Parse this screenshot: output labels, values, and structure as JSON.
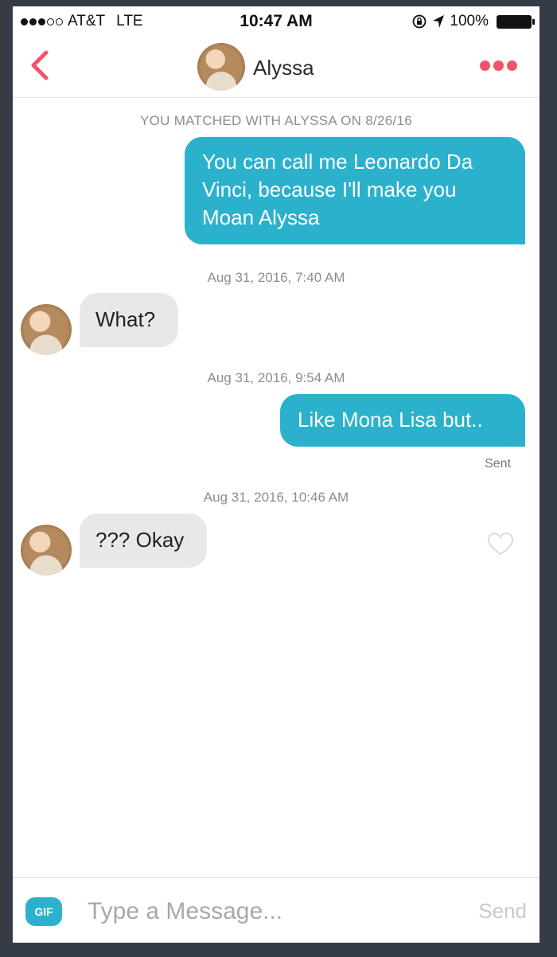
{
  "status_bar": {
    "carrier": "AT&T",
    "network": "LTE",
    "time": "10:47 AM",
    "battery": "100%"
  },
  "header": {
    "name": "Alyssa",
    "accent_color": "#f1536a"
  },
  "conversation": {
    "match_notice": "YOU MATCHED WITH ALYSSA ON 8/26/16",
    "messages": [
      {
        "from": "me",
        "text": "You can call me Leonardo Da Vinci, because I'll make you Moan Alyssa"
      },
      {
        "timestamp": "Aug 31, 2016, 7:40 AM"
      },
      {
        "from": "Alyssa",
        "text": "What?"
      },
      {
        "timestamp": "Aug 31, 2016, 9:54 AM"
      },
      {
        "from": "me",
        "text": "Like Mona Lisa but..",
        "status": "Sent"
      },
      {
        "timestamp": "Aug 31, 2016, 10:46 AM"
      },
      {
        "from": "Alyssa",
        "text": "??? Okay"
      }
    ],
    "sent_bubble_color": "#2cb1cd",
    "received_bubble_color": "#e8e8e8"
  },
  "composer": {
    "gif_label": "GIF",
    "placeholder": "Type a Message...",
    "send_label": "Send"
  },
  "icons": [
    "back-chevron-icon",
    "more-dots-icon",
    "heart-icon",
    "location-arrow-icon",
    "rotation-lock-icon",
    "battery-icon"
  ]
}
